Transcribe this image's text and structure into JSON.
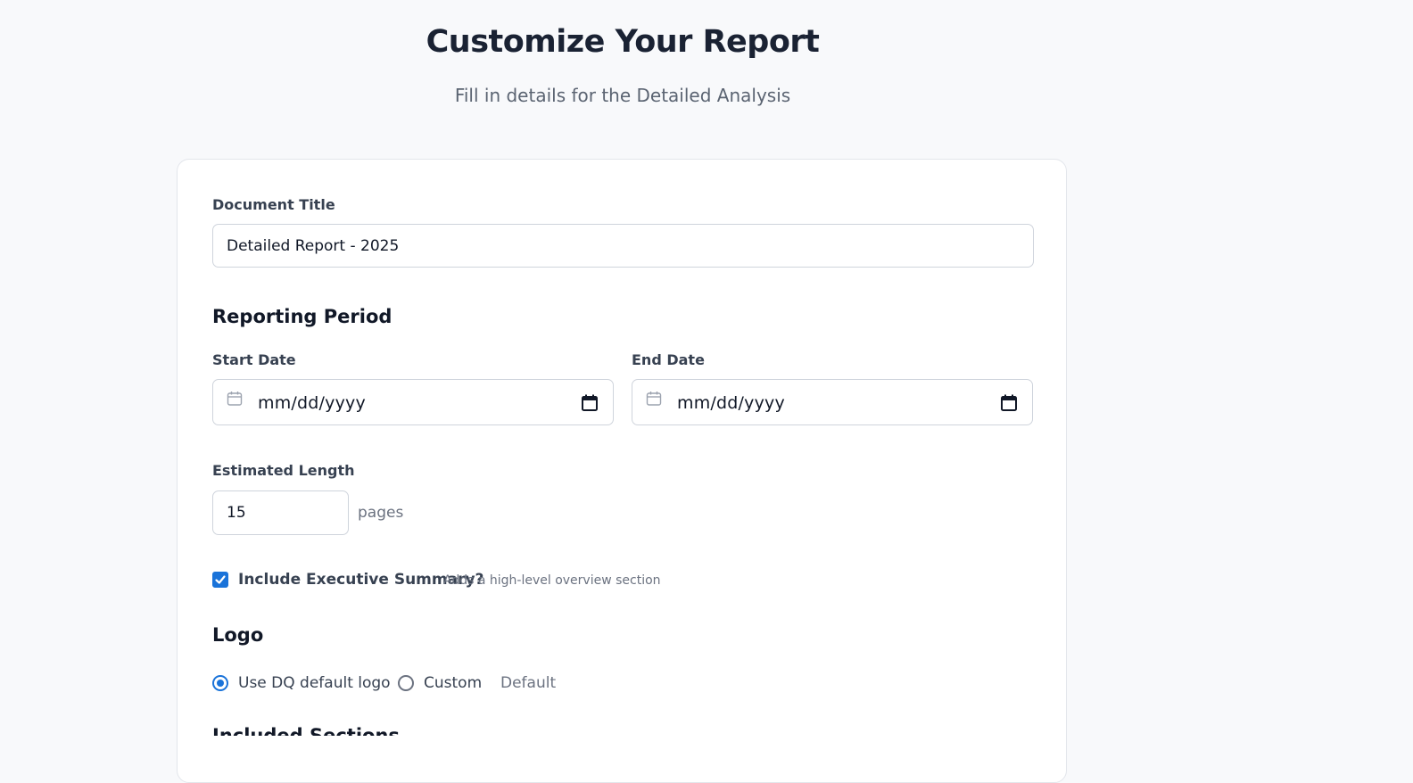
{
  "header": {
    "title": "Customize Your Report",
    "subtitle": "Fill in details for the Detailed Analysis"
  },
  "form": {
    "document_title": {
      "label": "Document Title",
      "value": "Detailed Report - 2025"
    },
    "reporting_period": {
      "section_title": "Reporting Period",
      "start_date": {
        "label": "Start Date",
        "placeholder": "mm/dd/yyyy"
      },
      "end_date": {
        "label": "End Date",
        "placeholder": "mm/dd/yyyy"
      }
    },
    "estimated_length": {
      "label": "Estimated Length",
      "value": "15",
      "unit": "pages"
    },
    "executive_summary": {
      "label": "Include Executive Summary?",
      "hint": "Adds a high-level overview section",
      "checked": true
    },
    "logo": {
      "section_title": "Logo",
      "options": [
        {
          "label": "Use DQ default logo",
          "selected": true
        },
        {
          "label": "Custom",
          "selected": false
        }
      ],
      "state_text": "Default"
    },
    "next_section_partial": "Included Sections"
  },
  "colors": {
    "accent": "#1a73d9",
    "background": "#f8f9fb",
    "card": "#ffffff",
    "border": "#cfd4dc"
  }
}
